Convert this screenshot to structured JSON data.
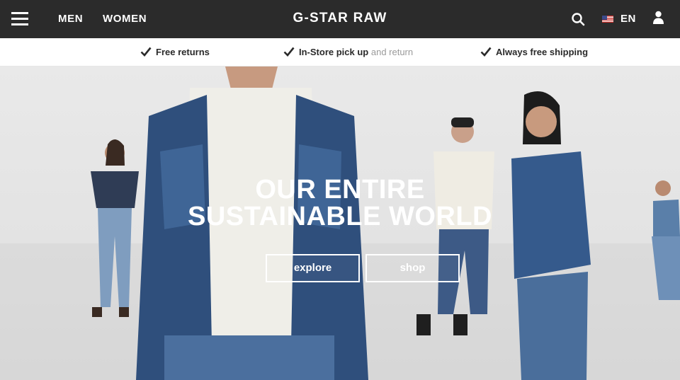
{
  "header": {
    "nav": [
      "MEN",
      "WOMEN"
    ],
    "logo": "G-STAR RAW",
    "language": "EN"
  },
  "usp": [
    {
      "strong": "Free returns",
      "light": ""
    },
    {
      "strong": "In-Store pick up",
      "light": "and return"
    },
    {
      "strong": "Always free shipping",
      "light": ""
    }
  ],
  "hero": {
    "title_line1": "OUR ENTIRE",
    "title_line2": "SUSTAINABLE WORLD",
    "explore_label": "explore",
    "shop_label": "shop"
  },
  "icons": {
    "menu": "hamburger-menu-icon",
    "search": "search-icon",
    "flag": "us-flag-icon",
    "user": "user-icon",
    "check": "checkmark-icon"
  },
  "colors": {
    "topbar": "#2b2b2b",
    "text_dark": "#2a2a2a",
    "text_light": "#9a9a9a",
    "hero_background": "#e3e3e3",
    "denim": "#3d5a86"
  }
}
